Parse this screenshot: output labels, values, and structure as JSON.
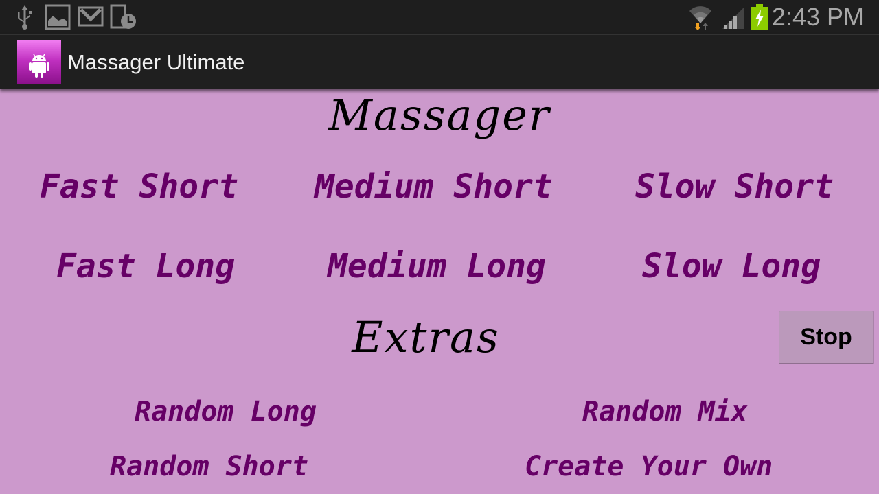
{
  "status_bar": {
    "icons_left": [
      "usb-icon",
      "image-icon",
      "gmail-icon",
      "device-clock-icon"
    ],
    "icons_right": [
      "wifi-icon",
      "signal-icon",
      "battery-charging-icon"
    ],
    "time": "2:43 PM",
    "colors": {
      "battery": "#8ccc00",
      "wifi_download_arrow": "#f0a020"
    }
  },
  "action_bar": {
    "app_icon": "android-icon",
    "title": "Massager Ultimate"
  },
  "main": {
    "heading": "Massager",
    "options": [
      {
        "label": "Fast Short"
      },
      {
        "label": "Medium Short"
      },
      {
        "label": "Slow Short"
      },
      {
        "label": "Fast Long"
      },
      {
        "label": "Medium Long"
      },
      {
        "label": "Slow Long"
      }
    ],
    "extras_heading": "Extras",
    "extras": [
      {
        "label": "Random Long"
      },
      {
        "label": "Random Mix"
      },
      {
        "label": "Random Short"
      },
      {
        "label": "Create Your Own"
      }
    ],
    "stop_label": "Stop"
  },
  "colors": {
    "background": "#cc99cc",
    "option_text": "#660066",
    "heading_text": "#000000"
  }
}
